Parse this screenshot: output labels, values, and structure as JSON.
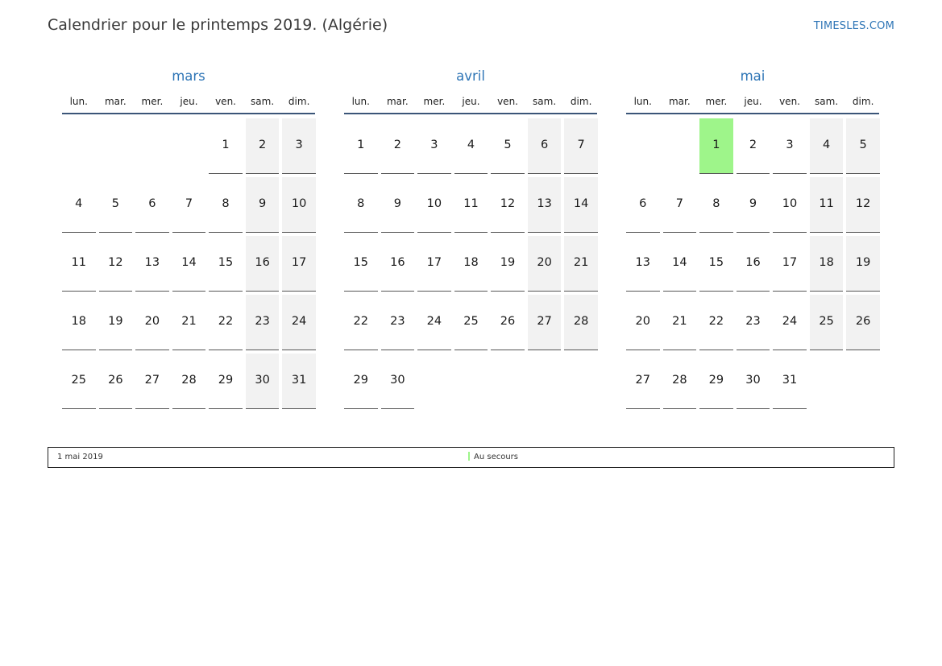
{
  "page": {
    "title": "Calendrier pour le printemps 2019. (Algérie)",
    "brand": "TIMESLES.COM"
  },
  "colors": {
    "accent": "#2e75b6",
    "weekend_bg": "#f2f2f2",
    "holiday_bg": "#9ef58a",
    "rule": "#3b5578"
  },
  "weekdays": [
    "lun.",
    "mar.",
    "mer.",
    "jeu.",
    "ven.",
    "sam.",
    "dim."
  ],
  "months": [
    {
      "name": "mars",
      "first_weekday": 4,
      "days_in_month": 31,
      "holidays": []
    },
    {
      "name": "avril",
      "first_weekday": 0,
      "days_in_month": 30,
      "holidays": []
    },
    {
      "name": "mai",
      "first_weekday": 2,
      "days_in_month": 31,
      "holidays": [
        1
      ]
    }
  ],
  "legend": {
    "date": "1 mai 2019",
    "item_label": "Au secours",
    "item_color": "#9ef58a"
  }
}
